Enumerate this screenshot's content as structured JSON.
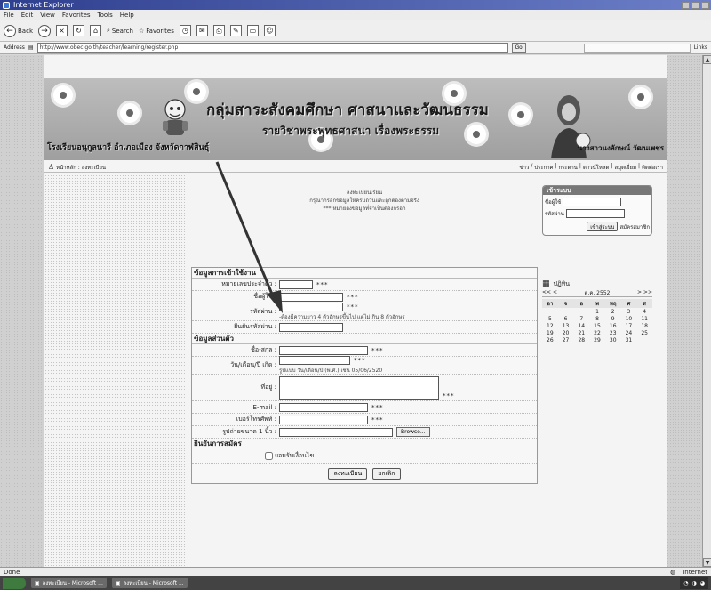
{
  "window": {
    "title": "Internet Explorer"
  },
  "menu": [
    "File",
    "Edit",
    "View",
    "Favorites",
    "Tools",
    "Help"
  ],
  "toolbar": {
    "back_label": "Back",
    "search_label": "Search",
    "favorites_label": "Favorites"
  },
  "address": {
    "label": "Address",
    "url": "http://www.obec.go.th/teacher/learning/register.php",
    "go_label": "Go",
    "links_label": "Links"
  },
  "banner": {
    "title": "กลุ่มสาระสังคมศึกษา ศาสนาและวัฒนธรรม",
    "subtitle": "รายวิชาพระพุทธศาสนา เรื่องพระธรรม",
    "school": "โรงเรียนอนุกูลนารี อำเภอเมือง จังหวัดกาฬสินธุ์",
    "teacher": "นางสาวนงลักษณ์ วัฒนเพชร"
  },
  "nav": {
    "breadcrumb": "หน้าหลัก : ลงทะเบียน",
    "links": [
      "ข่าว",
      "ประกาศ",
      "กระดาน",
      "ดาวน์โหลด",
      "สมุดเยี่ยม",
      "ติดต่อเรา"
    ]
  },
  "notice": {
    "line1": "ลงทะเบียนเรียน",
    "line2": "กรุณากรอกข้อมูลให้ครบถ้วนและถูกต้องตามจริง",
    "line3": "*** หมายถึงข้อมูลที่จำเป็นต้องกรอก"
  },
  "form": {
    "section_account": "ข้อมูลการเข้าใช้งาน",
    "section_personal": "ข้อมูลส่วนตัว",
    "section_confirm": "ยืนยันการสมัคร",
    "required_mark": "***",
    "fields": {
      "student_id": {
        "label": "หมายเลขประจำตัว :"
      },
      "username": {
        "label": "ชื่อผู้ใช้ :"
      },
      "password": {
        "label": "รหัสผ่าน :",
        "hint": "-ต้องมีความยาว 4 ตัวอักษรขึ้นไป แต่ไม่เกิน 8 ตัวอักษร"
      },
      "confirm_password": {
        "label": "ยืนยันรหัสผ่าน :"
      },
      "fullname": {
        "label": "ชื่อ-สกุล :"
      },
      "birthdate": {
        "label": "วัน/เดือน/ปี เกิด :",
        "hint": "รูปแบบ วัน/เดือน/ปี (พ.ศ.) เช่น 05/06/2520"
      },
      "address": {
        "label": "ที่อยู่ :"
      },
      "email": {
        "label": "E-mail :"
      },
      "phone": {
        "label": "เบอร์โทรศัพท์ :"
      },
      "photo": {
        "label": "รูปถ่ายขนาด 1 นิ้ว :",
        "browse_label": "Browse..."
      }
    },
    "agree_label": "ยอมรับเงื่อนไข",
    "submit_label": "ลงทะเบียน",
    "cancel_label": "ยกเลิก"
  },
  "login": {
    "title": "เข้าระบบ",
    "username_label": "ชื่อผู้ใช้",
    "password_label": "รหัสผ่าน",
    "login_label": "เข้าสู่ระบบ",
    "register_label": "สมัครสมาชิก"
  },
  "calendar": {
    "title": "ปฏิทิน",
    "month": "ต.ค. 2552",
    "prev": "<< <",
    "next": "> >>",
    "day_heads": [
      "อา",
      "จ",
      "อ",
      "พ",
      "พฤ",
      "ศ",
      "ส"
    ],
    "days": [
      "",
      "",
      "",
      "1",
      "2",
      "3",
      "4",
      "5",
      "6",
      "7",
      "8",
      "9",
      "10",
      "11",
      "12",
      "13",
      "14",
      "15",
      "16",
      "17",
      "18",
      "19",
      "20",
      "21",
      "22",
      "23",
      "24",
      "25",
      "26",
      "27",
      "28",
      "29",
      "30",
      "31",
      ""
    ]
  },
  "status": {
    "left": "Done",
    "zone": "Internet"
  },
  "taskbar": {
    "tasks": [
      "ลงทะเบียน - Microsoft ...",
      "ลงทะเบียน - Microsoft ..."
    ]
  }
}
